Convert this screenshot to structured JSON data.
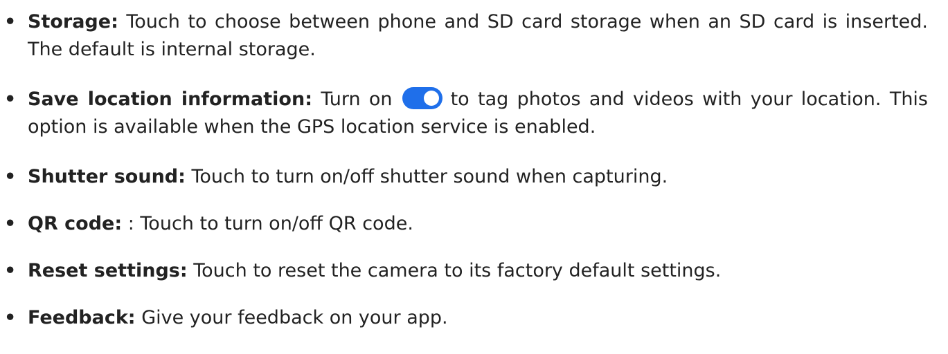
{
  "bullet_char": "•",
  "colors": {
    "toggle_on": "#1f6fea",
    "text": "#222222"
  },
  "icons": {
    "toggle": "toggle-switch-on-icon"
  },
  "items": [
    {
      "term": "Storage:",
      "text": " Touch to choose between phone and SD card storage when an SD card is inserted. The default is internal storage."
    },
    {
      "term": "Save location information:",
      "text_before": " Turn on",
      "text_after": "to tag photos and videos with your location. This option is available when the GPS location service is enabled."
    },
    {
      "term": "Shutter sound:",
      "text": " Touch to turn on/off shutter sound when capturing."
    },
    {
      "term": "QR code:",
      "text": " : Touch to turn on/off QR code."
    },
    {
      "term": "Reset settings:",
      "text": " Touch to reset the camera to its factory default settings."
    },
    {
      "term": "Feedback:",
      "text": " Give your feedback on your app."
    }
  ]
}
